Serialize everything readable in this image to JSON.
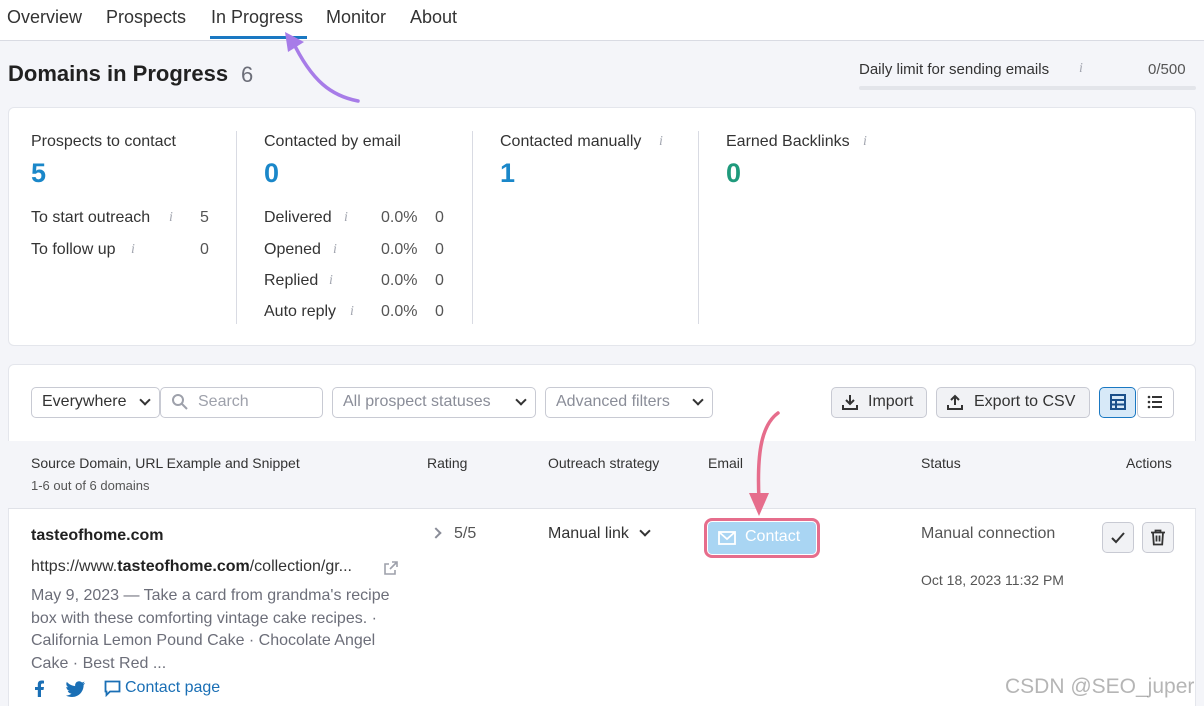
{
  "nav": {
    "tabs": [
      {
        "label": "Overview"
      },
      {
        "label": "Prospects"
      },
      {
        "label": "In Progress"
      },
      {
        "label": "Monitor"
      },
      {
        "label": "About"
      }
    ]
  },
  "header": {
    "title": "Domains in Progress",
    "count": "6",
    "daily_limit_label": "Daily limit for sending emails",
    "daily_limit_value": "0/500",
    "daily_limit_fraction": 0
  },
  "stats": {
    "prospects": {
      "label": "Prospects to contact",
      "value": "5",
      "rows": [
        {
          "label": "To start outreach",
          "value": "5"
        },
        {
          "label": "To follow up",
          "value": "0"
        }
      ]
    },
    "email": {
      "label": "Contacted by email",
      "value": "0",
      "rows": [
        {
          "label": "Delivered",
          "pct": "0.0%",
          "value": "0"
        },
        {
          "label": "Opened",
          "pct": "0.0%",
          "value": "0"
        },
        {
          "label": "Replied",
          "pct": "0.0%",
          "value": "0"
        },
        {
          "label": "Auto reply",
          "pct": "0.0%",
          "value": "0"
        }
      ]
    },
    "manual": {
      "label": "Contacted manually",
      "value": "1"
    },
    "backlinks": {
      "label": "Earned Backlinks",
      "value": "0"
    }
  },
  "toolbar": {
    "scope": "Everywhere",
    "search_placeholder": "Search",
    "statuses": "All prospect statuses",
    "filters": "Advanced filters",
    "import": "Import",
    "export": "Export to CSV"
  },
  "table": {
    "columns": {
      "source": "Source Domain, URL Example and Snippet",
      "source_sub": "1-6 out of 6 domains",
      "rating": "Rating",
      "strategy": "Outreach strategy",
      "email": "Email",
      "status": "Status",
      "actions": "Actions"
    },
    "rows": [
      {
        "domain": "tasteofhome.com",
        "url_prefix": "https://www.",
        "url_domain": "tasteofhome.com",
        "url_suffix": "/collection/gr...",
        "snippet": "May 9, 2023 — Take a card from grandma's recipe box with these comforting vintage cake recipes. · California Lemon Pound Cake · Chocolate Angel Cake · Best Red ...",
        "contact_page": "Contact page",
        "rating": "5/5",
        "strategy": "Manual link",
        "email_button": "Contact",
        "status": "Manual connection",
        "status_date": "Oct 18, 2023 11:32 PM"
      }
    ]
  },
  "watermark": "CSDN @SEO_juper",
  "colors": {
    "accent": "#1a78c2",
    "stat_blue": "#1a87c9",
    "stat_green": "#1f9a7c",
    "annotation_purple": "#a77ce8",
    "annotation_pink": "#e66d8c"
  }
}
